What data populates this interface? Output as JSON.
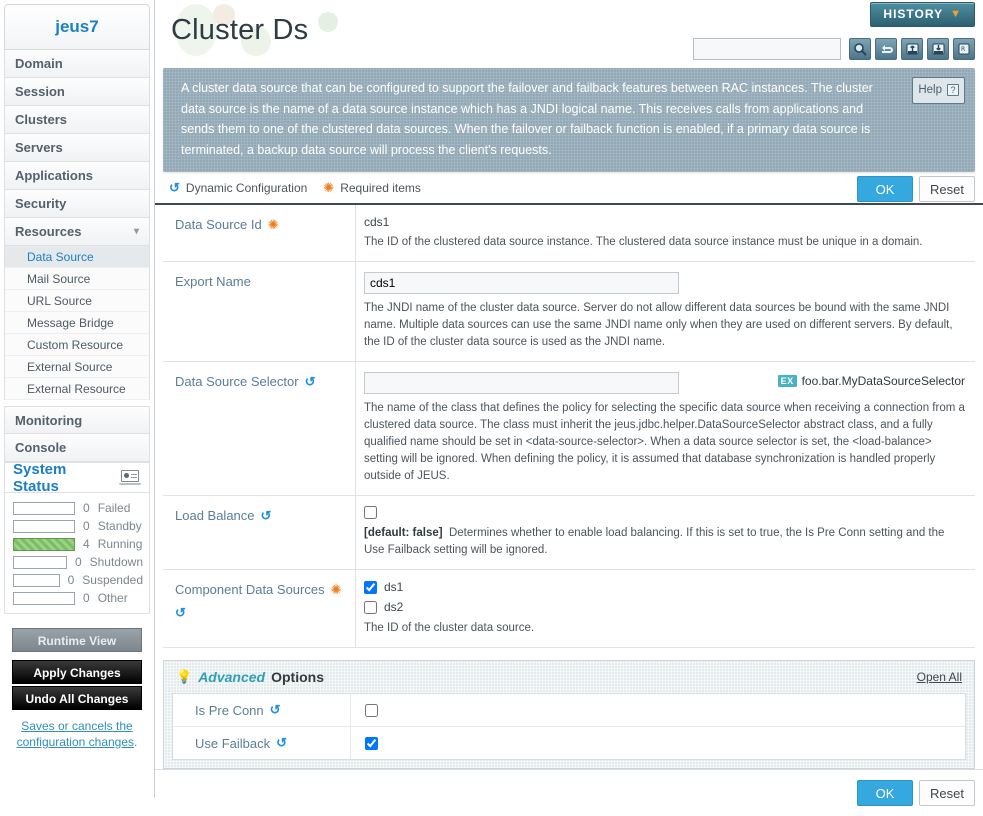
{
  "sidebar": {
    "logo": "jeus7",
    "nav": [
      {
        "label": "Domain"
      },
      {
        "label": "Session"
      },
      {
        "label": "Clusters"
      },
      {
        "label": "Servers"
      },
      {
        "label": "Applications"
      },
      {
        "label": "Security"
      },
      {
        "label": "Resources",
        "expanded": true,
        "chevron": "chevron-down-icon"
      }
    ],
    "sub_items": [
      {
        "label": "Data Source",
        "active": true
      },
      {
        "label": "Mail Source",
        "active": false
      },
      {
        "label": "URL Source",
        "active": false
      },
      {
        "label": "Message Bridge",
        "active": false
      },
      {
        "label": "Custom Resource",
        "active": false
      },
      {
        "label": "External Source",
        "active": false
      },
      {
        "label": "External Resource",
        "active": false
      }
    ],
    "nav_bottom": [
      {
        "label": "Monitoring"
      },
      {
        "label": "Console"
      }
    ],
    "status": {
      "title": "System Status",
      "icon": "monitor-icon",
      "rows": [
        {
          "count": "0",
          "label": "Failed",
          "filled": false
        },
        {
          "count": "0",
          "label": "Standby",
          "filled": false
        },
        {
          "count": "4",
          "label": "Running",
          "filled": true
        },
        {
          "count": "0",
          "label": "Shutdown",
          "filled": false
        },
        {
          "count": "0",
          "label": "Suspended",
          "filled": false
        },
        {
          "count": "0",
          "label": "Other",
          "filled": false
        }
      ]
    },
    "actions": {
      "runtime_view": "Runtime View",
      "apply_changes": "Apply Changes",
      "undo_all": "Undo All Changes",
      "note": "Saves or cancels the configuration changes",
      "note_suffix": "."
    }
  },
  "header": {
    "title": "Cluster Ds",
    "history_label": "HISTORY",
    "search_value": "",
    "search_placeholder": "",
    "tools": [
      {
        "name": "search-icon",
        "title": "Search"
      },
      {
        "name": "reload-icon",
        "title": "Reload"
      },
      {
        "name": "xml-import-icon",
        "title": "Import XML"
      },
      {
        "name": "xml-export-icon",
        "title": "Export XML"
      },
      {
        "name": "restore-icon",
        "title": "Restore"
      }
    ]
  },
  "description": {
    "text": "A cluster data source that can be configured to support the failover and failback features between RAC instances. The cluster data source is the name of a data source instance which has a JNDI logical name. This receives calls from applications and sends them to one of the clustered data sources. When the failover or failback function is enabled, if a primary data source is terminated, a backup data source will process the client's requests.",
    "help_label": "Help",
    "help_glyph": "?"
  },
  "actionstrip": {
    "dynamic_config": "Dynamic Configuration",
    "required_items": "Required items",
    "ok": "OK",
    "reset": "Reset"
  },
  "form": {
    "rows": [
      {
        "label": "Data Source Id",
        "required": true,
        "dynamic": false,
        "kind": "readonly",
        "value": "cds1",
        "desc": "The ID of the clustered data source instance. The clustered data source instance must be unique in a domain."
      },
      {
        "label": "Export Name",
        "required": false,
        "dynamic": false,
        "kind": "text",
        "value": "cds1",
        "desc": "The JNDI name of the cluster data source. Server do not allow different data sources be bound with the same JNDI name. Multiple data sources can use the same JNDI name only when they are used on different servers. By default, the ID of the cluster data source is used as the JNDI name."
      },
      {
        "label": "Data Source Selector",
        "required": false,
        "dynamic": true,
        "kind": "text",
        "value": "",
        "example_badge": "EX",
        "example": "foo.bar.MyDataSourceSelector",
        "desc": "The name of the class that defines the policy for selecting the specific data source when receiving a connection from a clustered data source. The class must inherit the jeus.jdbc.helper.DataSourceSelector abstract class, and a fully qualified name should be set in <data-source-selector>. When a data source selector is set, the <load-balance> setting will be ignored. When defining the policy, it is assumed that database synchronization is handled properly outside of JEUS."
      },
      {
        "label": "Load Balance",
        "required": false,
        "dynamic": true,
        "kind": "checkbox",
        "checked": false,
        "default_text": "[default: false]",
        "desc": "Determines whether to enable load balancing. If this is set to true, the Is Pre Conn setting and the Use Failback setting will be ignored."
      },
      {
        "label": "Component Data Sources",
        "required": true,
        "dynamic": true,
        "kind": "checkbox-list",
        "items": [
          {
            "label": "ds1",
            "checked": true
          },
          {
            "label": "ds2",
            "checked": false
          }
        ],
        "desc": "The ID of the cluster data source."
      }
    ]
  },
  "advanced": {
    "title_accent": "Advanced",
    "title_rest": "Options",
    "open_all": "Open All",
    "rows": [
      {
        "label": "Is Pre Conn",
        "dynamic": true,
        "checked": false
      },
      {
        "label": "Use Failback",
        "dynamic": true,
        "checked": true
      }
    ]
  },
  "footer": {
    "ok": "OK",
    "reset": "Reset"
  }
}
